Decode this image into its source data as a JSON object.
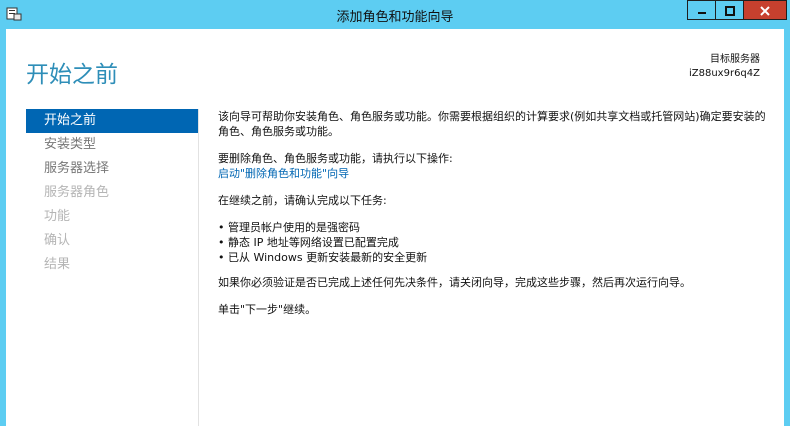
{
  "window": {
    "title": "添加角色和功能向导",
    "minimize_icon": "minimize-icon",
    "maximize_icon": "maximize-icon",
    "close_icon": "close-icon",
    "app_icon": "server-manager-icon"
  },
  "page_title": "开始之前",
  "target_server": {
    "label": "目标服务器",
    "name": "iZ88ux9r6q4Z"
  },
  "nav": {
    "items": [
      {
        "label": "开始之前",
        "state": "active"
      },
      {
        "label": "安装类型",
        "state": "enabled"
      },
      {
        "label": "服务器选择",
        "state": "enabled"
      },
      {
        "label": "服务器角色",
        "state": "disabled"
      },
      {
        "label": "功能",
        "state": "disabled"
      },
      {
        "label": "确认",
        "state": "disabled"
      },
      {
        "label": "结果",
        "state": "disabled"
      }
    ]
  },
  "content": {
    "intro": "该向导可帮助你安装角色、角色服务或功能。你需要根据组织的计算要求(例如共享文档或托管网站)确定要安装的角色、角色服务或功能。",
    "remove_instruction": "要删除角色、角色服务或功能，请执行以下操作:",
    "remove_link": "启动\"删除角色和功能\"向导",
    "before_continue": "在继续之前，请确认完成以下任务:",
    "tasks": [
      "管理员帐户使用的是强密码",
      "静态 IP 地址等网络设置已配置完成",
      "已从 Windows 更新安装最新的安全更新"
    ],
    "verify_note": "如果你必须验证是否已完成上述任何先决条件，请关闭向导，完成这些步骤，然后再次运行向导。",
    "next_note": "单击\"下一步\"继续。"
  },
  "colors": {
    "chrome": "#5dcdf2",
    "accent": "#0066b3",
    "title_blue": "#2e8eb8",
    "close_red": "#c7402e"
  }
}
